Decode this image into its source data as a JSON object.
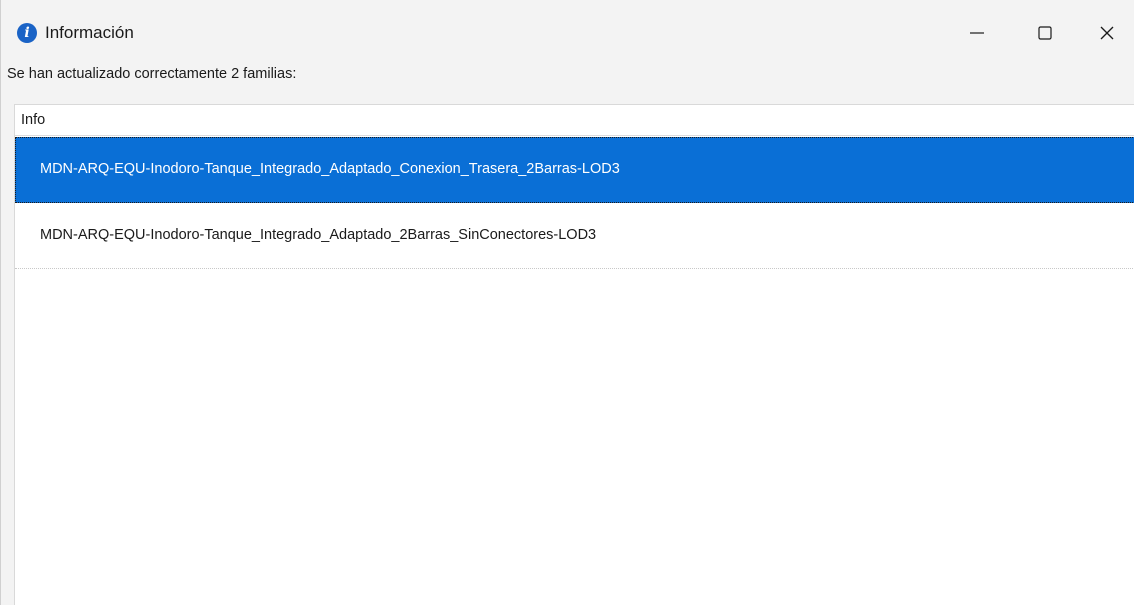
{
  "window": {
    "title": "Información",
    "icon": "info-icon",
    "controls": {
      "minimize": "minimize-icon",
      "maximize": "maximize-icon",
      "close": "close-icon"
    }
  },
  "message": "Se han actualizado correctamente 2 familias:",
  "list": {
    "columns": [
      "Info"
    ],
    "rows": [
      {
        "text": "MDN-ARQ-EQU-Inodoro-Tanque_Integrado_Adaptado_Conexion_Trasera_2Barras-LOD3",
        "selected": true
      },
      {
        "text": "MDN-ARQ-EQU-Inodoro-Tanque_Integrado_Adaptado_2Barras_SinConectores-LOD3",
        "selected": false
      }
    ]
  },
  "colors": {
    "selection": "#0a6fd6",
    "info_icon": "#1a63c6"
  }
}
